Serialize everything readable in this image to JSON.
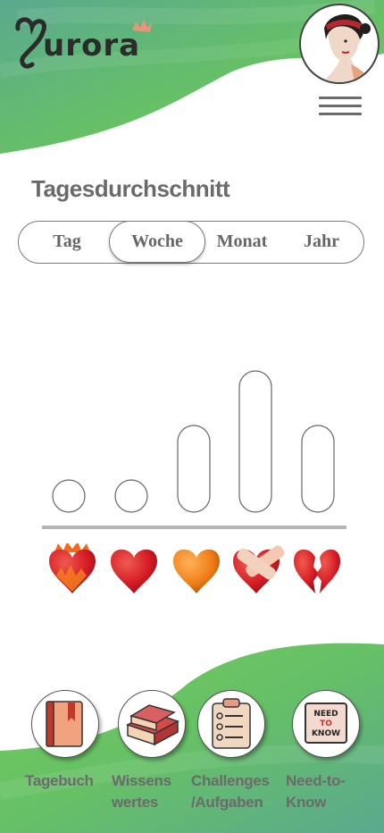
{
  "app": {
    "name": "Aurora"
  },
  "header": {
    "menu_icon": "hamburger-menu-icon",
    "avatar_icon": "profile-avatar-icon"
  },
  "main": {
    "title": "Tagesdurchschnitt",
    "tabs": [
      {
        "label": "Tag",
        "active": false
      },
      {
        "label": "Woche",
        "active": true
      },
      {
        "label": "Monat",
        "active": false
      },
      {
        "label": "Jahr",
        "active": false
      }
    ]
  },
  "chart_data": {
    "type": "bar",
    "categories": [
      "burning-heart",
      "red-heart",
      "orange-heart",
      "bandaged-heart",
      "broken-heart"
    ],
    "values": [
      0,
      0,
      2,
      4,
      2
    ],
    "ylim": [
      0,
      4
    ],
    "grid": false,
    "colors": {
      "bar_fill": "#ffffff",
      "bar_stroke": "#666666",
      "baseline": "#b5b5b5"
    }
  },
  "bottom_nav": [
    {
      "label": "Tagebuch",
      "icon": "diary-book-icon"
    },
    {
      "label": "Wissens\nwertes",
      "icon": "books-stack-icon"
    },
    {
      "label": "Challenges\n/Aufgaben",
      "icon": "checklist-clipboard-icon"
    },
    {
      "label": "Need-to-\nKnow",
      "icon": "need-to-know-sign-icon"
    }
  ],
  "need_to_know_sign": "NEED TO KNOW",
  "colors": {
    "wave_green": "#6ccb5c",
    "wave_teal": "#5aae8f",
    "text_gray": "#6a6a6a",
    "logo_dark": "#2b2b2b",
    "crown": "#e8967a"
  }
}
